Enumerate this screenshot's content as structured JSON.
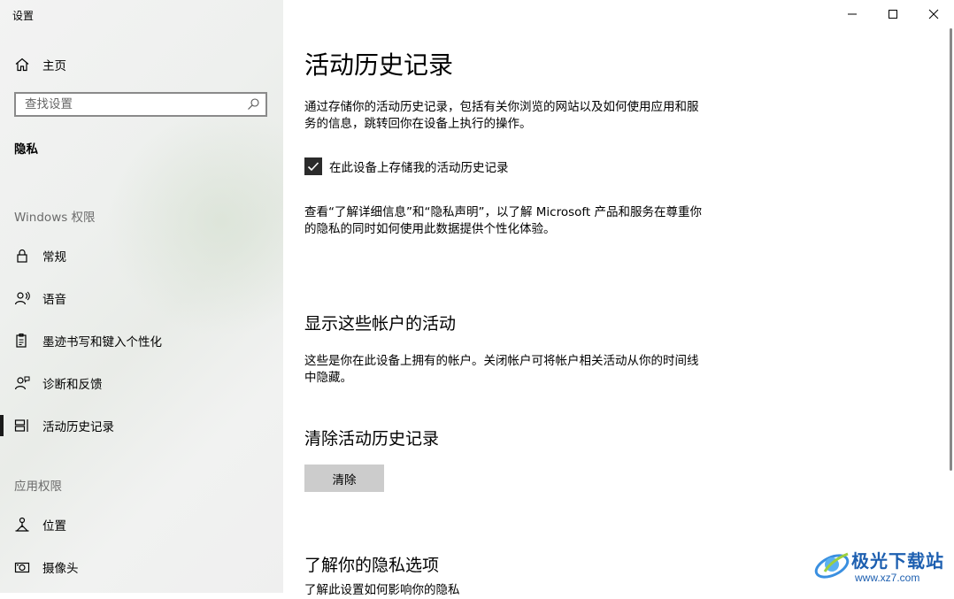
{
  "window": {
    "title": "设置"
  },
  "sidebar": {
    "home_label": "主页",
    "search_placeholder": "查找设置",
    "section_title": "隐私",
    "windows_group": "Windows 权限",
    "windows_items": [
      {
        "label": "常规",
        "icon": "lock-icon"
      },
      {
        "label": "语音",
        "icon": "speech-icon"
      },
      {
        "label": "墨迹书写和键入个性化",
        "icon": "clipboard-pen-icon"
      },
      {
        "label": "诊断和反馈",
        "icon": "feedback-person-icon"
      },
      {
        "label": "活动历史记录",
        "icon": "timeline-icon",
        "selected": true
      }
    ],
    "app_group": "应用权限",
    "app_items": [
      {
        "label": "位置",
        "icon": "location-person-icon"
      },
      {
        "label": "摄像头",
        "icon": "camera-icon"
      }
    ]
  },
  "main": {
    "title": "活动历史记录",
    "intro": "通过存储你的活动历史记录，包括有关你浏览的网站以及如何使用应用和服务的信息，跳转回你在设备上执行的操作。",
    "store_checkbox": {
      "label": "在此设备上存储我的活动历史记录",
      "checked": true
    },
    "privacy_note": "查看“了解详细信息”和“隐私声明”，以了解 Microsoft 产品和服务在尊重你的隐私的同时如何使用此数据提供个性化体验。",
    "accounts_heading": "显示这些帐户的活动",
    "accounts_text": "这些是你在此设备上拥有的帐户。关闭帐户可将帐户相关活动从你的时间线中隐藏。",
    "clear_heading": "清除活动历史记录",
    "clear_button": "清除",
    "learn_heading": "了解你的隐私选项",
    "learn_text": "了解此设置如何影响你的隐私"
  },
  "watermark": {
    "title": "极光下载站",
    "url": "www.xz7.com"
  },
  "colors": {
    "accent": "#2b2b2b",
    "button": "#cccccc",
    "watermark": "#1d5fb0"
  }
}
